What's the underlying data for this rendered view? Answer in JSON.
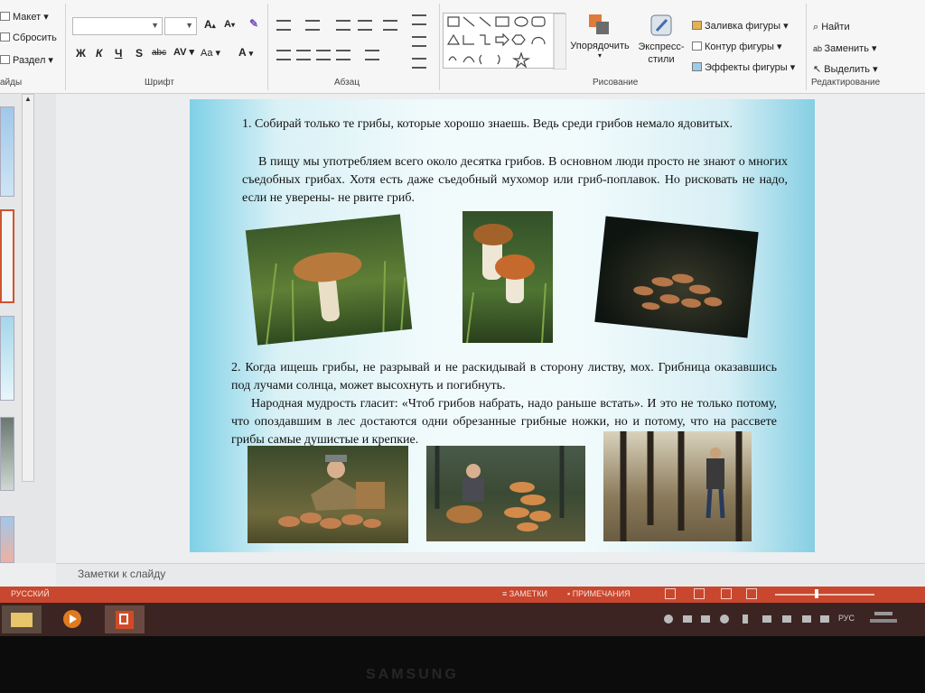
{
  "ribbon": {
    "slides_group": {
      "label": "айды",
      "items": [
        "Макет",
        "Сбросить",
        "Раздел"
      ]
    },
    "font_group": {
      "label": "Шрифт",
      "buttons": [
        "Ж",
        "К",
        "Ч",
        "S",
        "abc",
        "AV",
        "Aa",
        "A"
      ]
    },
    "paragraph_group": {
      "label": "Абзац"
    },
    "drawing_group": {
      "label": "Рисование",
      "arrange_label": "Упорядочить",
      "quick_styles_label": "Экспресс-стили",
      "fill_label": "Заливка фигуры",
      "outline_label": "Контур фигуры",
      "effects_label": "Эффекты фигуры"
    },
    "editing_group": {
      "label": "Редактирование",
      "find_label": "Найти",
      "replace_label": "Заменить",
      "select_label": "Выделить"
    }
  },
  "slide": {
    "para1": "1. Собирай только те грибы, которые хорошо знаешь. Ведь среди грибов немало ядовитых.",
    "para1b": "В пищу мы употребляем всего около десятка грибов. В основном люди просто не знают о многих съедобных грибах. Хотя есть даже съедобный мухомор или гриб-поплавок. Но рисковать не надо, если не уверены- не рвите гриб.",
    "para2": "2. Когда ищешь грибы, не разрывай и не раскидывай в сторону листву, мох. Грибница оказавшись под лучами солнца, может высохнуть и погибнуть.",
    "para2b": "Народная мудрость гласит: «Чтоб грибов набрать, надо раньше встать». И это не только потому, что опоздавшим в лес достаются одни обрезанные грибные ножки, но и потому, что на рассвете грибы самые душистые и крепкие."
  },
  "notes": {
    "placeholder": "Заметки к слайду"
  },
  "status": {
    "language": "РУССКИЙ",
    "notes_btn": "ЗАМЕТКИ",
    "comments_btn": "ПРИМЕЧАНИЯ"
  },
  "tray": {
    "lang": "РУС"
  },
  "bezel": {
    "brand": "SAMSUNG"
  }
}
